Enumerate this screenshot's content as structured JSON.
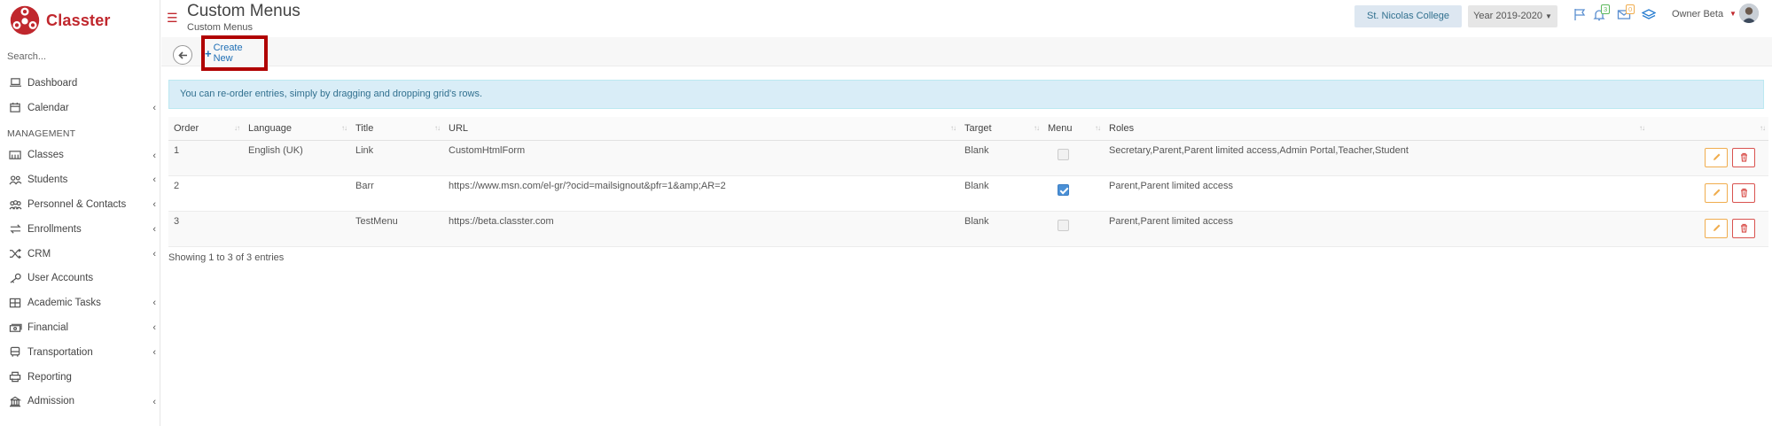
{
  "app": {
    "brand": "Classter"
  },
  "sidebar": {
    "search_placeholder": "Search...",
    "items_top": [
      {
        "label": "Dashboard",
        "icon": "laptop-icon",
        "chevron": false
      },
      {
        "label": "Calendar",
        "icon": "calendar-icon",
        "chevron": true
      }
    ],
    "section_label": "MANAGEMENT",
    "items": [
      {
        "label": "Classes",
        "icon": "classes-icon",
        "chevron": true
      },
      {
        "label": "Students",
        "icon": "students-icon",
        "chevron": true
      },
      {
        "label": "Personnel & Contacts",
        "icon": "personnel-icon",
        "chevron": true
      },
      {
        "label": "Enrollments",
        "icon": "exchange-icon",
        "chevron": true
      },
      {
        "label": "CRM",
        "icon": "shuffle-icon",
        "chevron": true
      },
      {
        "label": "User Accounts",
        "icon": "key-icon",
        "chevron": false
      },
      {
        "label": "Academic Tasks",
        "icon": "table-icon",
        "chevron": true
      },
      {
        "label": "Financial",
        "icon": "money-icon",
        "chevron": true
      },
      {
        "label": "Transportation",
        "icon": "bus-icon",
        "chevron": true
      },
      {
        "label": "Reporting",
        "icon": "print-icon",
        "chevron": false
      },
      {
        "label": "Admission",
        "icon": "building-icon",
        "chevron": true
      }
    ]
  },
  "header": {
    "title": "Custom Menus",
    "subtitle": "Custom Menus",
    "college": "St. Nicolas College",
    "year": "Year 2019-2020",
    "notifications_count": "3",
    "messages_count": "0",
    "user_name": "Owner Beta"
  },
  "toolbar": {
    "create_label": "Create New"
  },
  "info": {
    "text": "You can re-order entries, simply by dragging and dropping grid's rows."
  },
  "grid": {
    "columns": [
      "Order",
      "Language",
      "Title",
      "URL",
      "Target",
      "Menu",
      "Roles",
      ""
    ],
    "rows": [
      {
        "order": "1",
        "language": "English (UK)",
        "title": "Link",
        "url": "CustomHtmlForm",
        "target": "Blank",
        "menu": false,
        "roles": "Secretary,Parent,Parent limited access,Admin Portal,Teacher,Student"
      },
      {
        "order": "2",
        "language": "",
        "title": "Barr",
        "url": "https://www.msn.com/el-gr/?ocid=mailsignout&pfr=1&amp;AR=2",
        "target": "Blank",
        "menu": true,
        "roles": "Parent,Parent limited access"
      },
      {
        "order": "3",
        "language": "",
        "title": "TestMenu",
        "url": "https://beta.classter.com",
        "target": "Blank",
        "menu": false,
        "roles": "Parent,Parent limited access"
      }
    ],
    "footer": "Showing 1 to 3 of 3 entries"
  },
  "colors": {
    "brand": "#c0272d",
    "link": "#1f6fb5",
    "info_bg": "#d9edf7",
    "edit": "#f0ad4e",
    "delete": "#d9534f"
  }
}
